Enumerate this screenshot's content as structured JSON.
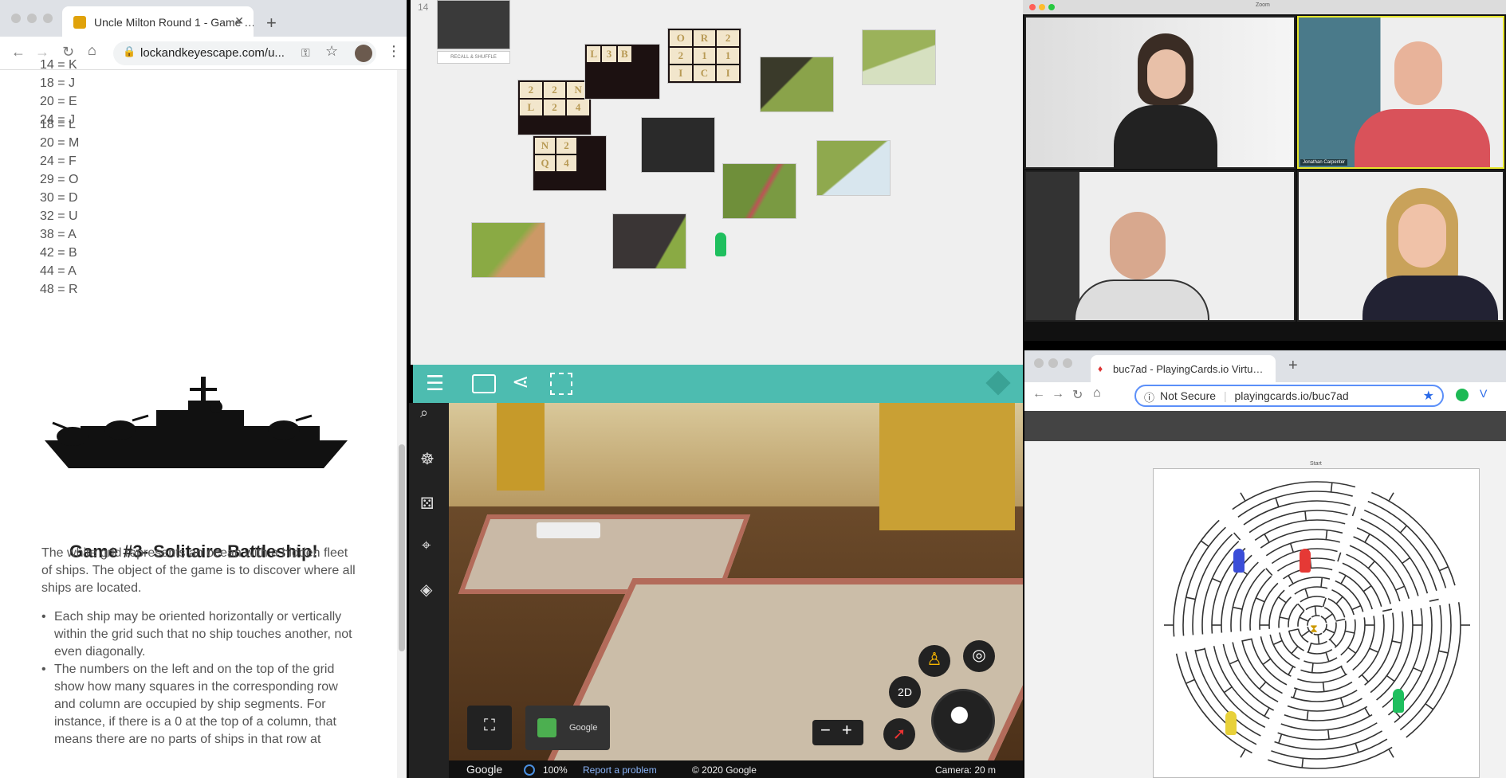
{
  "left_browser": {
    "tab_title": "Uncle Milton Round 1 - Game …",
    "url": "lockandkeyescape.com/u...",
    "cipher_a": [
      "14 = K",
      "18 = J",
      "20 = E",
      "24 = J"
    ],
    "cipher_b": [
      "18 = L",
      "20 = M",
      "24 = F",
      "29 = O",
      "30 = D",
      "32 = U",
      "38 = A",
      "42 = B",
      "44 = A",
      "48 = R"
    ],
    "game_title": "Game #3- Solitaire Battleship!",
    "intro": "The white grid represents an ocean with a hidden fleet of ships. The object of the game is to discover where all ships are located.",
    "bullets": [
      "Each ship may be oriented horizontally or vertically within the grid such that no ship touches another, not even diagonally.",
      "The numbers on the left and on the top of the grid show how many squares in the corresponding row and column are occupied by ship segments. For instance, if there is a 0 at the top of a column, that means there are no parts of ships in that row at"
    ]
  },
  "board": {
    "page_num": "14",
    "card_caption": "RECALL & SHUFFLE",
    "tiles_a": [
      "2",
      "2",
      "N",
      "L",
      "2",
      "4"
    ],
    "tiles_b": [
      "L",
      "3",
      "B"
    ],
    "tiles_c": [
      "O",
      "R",
      "2",
      "2",
      "1",
      "1",
      "I",
      "C",
      "I"
    ],
    "tiles_d": [
      "N",
      "2",
      "Q",
      "4"
    ],
    "pawn_color": "#1fbf5e"
  },
  "street_view": {
    "google": "Google",
    "zoom_pct": "100%",
    "report": "Report a problem",
    "copyright": "© 2020 Google",
    "camera": "Camera: 20 m",
    "btn_2d": "2D",
    "card_label": "Google"
  },
  "zoom": {
    "title": "Zoom",
    "tile_label": "Jonathan Carpenter"
  },
  "right_browser": {
    "tab_title": "buc7ad - PlayingCards.io Virtu…",
    "not_secure": "Not Secure",
    "url": "playingcards.io/buc7ad",
    "maze_start": "Start"
  }
}
